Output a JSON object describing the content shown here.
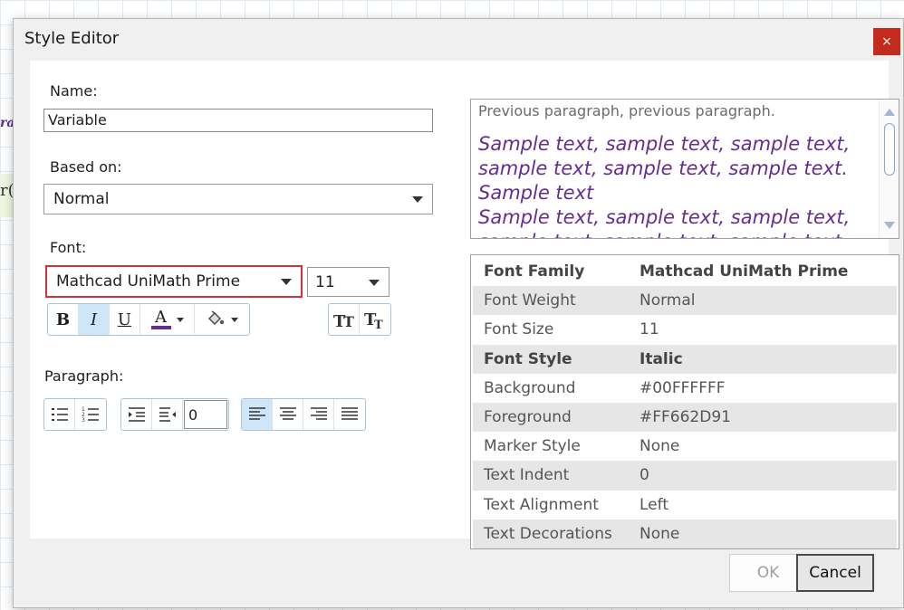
{
  "background": {
    "frag_top": "ra",
    "frag_mid": "r("
  },
  "dialog": {
    "title": "Style Editor",
    "close_glyph": "×"
  },
  "form": {
    "name_label": "Name:",
    "name_value": "Variable",
    "based_on_label": "Based on:",
    "based_on_value": "Normal",
    "font_label": "Font:",
    "font_family_value": "Mathcad UniMath Prime",
    "font_size_value": "11",
    "paragraph_label": "Paragraph:",
    "indent_value": "0"
  },
  "toolbar": {
    "bold": "B",
    "italic": "I",
    "underline": "U",
    "font_color": "A",
    "font_color_swatch": "#662D91"
  },
  "preview": {
    "previous_paragraph": "Previous paragraph, previous paragraph.",
    "sample_lines": [
      "Sample text, sample text, sample text,",
      "sample text, sample text, sample text.",
      "Sample text",
      "Sample text, sample text, sample text,",
      "sample text, sample text, sample text."
    ]
  },
  "properties": [
    {
      "key": "Font Family",
      "value": "Mathcad UniMath Prime",
      "bold": true
    },
    {
      "key": "Font Weight",
      "value": "Normal",
      "bold": false
    },
    {
      "key": "Font Size",
      "value": "11",
      "bold": false
    },
    {
      "key": "Font Style",
      "value": "Italic",
      "bold": true
    },
    {
      "key": "Background",
      "value": "#00FFFFFF",
      "bold": false
    },
    {
      "key": "Foreground",
      "value": "#FF662D91",
      "bold": false
    },
    {
      "key": "Marker Style",
      "value": "None",
      "bold": false
    },
    {
      "key": "Text Indent",
      "value": "0",
      "bold": false
    },
    {
      "key": "Text Alignment",
      "value": "Left",
      "bold": false
    },
    {
      "key": "Text Decorations",
      "value": "None",
      "bold": false
    }
  ],
  "footer": {
    "ok_label": "OK",
    "cancel_label": "Cancel"
  }
}
